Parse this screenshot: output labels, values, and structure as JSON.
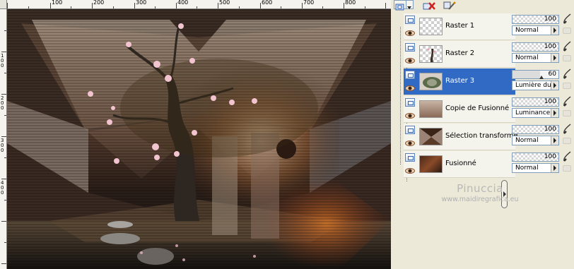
{
  "ruler": {
    "labels": [
      "100",
      "200",
      "300",
      "400",
      "500",
      "600",
      "700",
      "800"
    ],
    "vertical_labels": [
      "1",
      "0",
      "0",
      "2",
      "0",
      "0",
      "3",
      "0",
      "0",
      "4",
      "0",
      "0"
    ]
  },
  "toolbar": {
    "icons": [
      "new-layer-icon",
      "dropdown-arrow-icon",
      "delete-layer-icon",
      "layer-properties-icon"
    ]
  },
  "layers": [
    {
      "name": "Raster 1",
      "selected": false
    },
    {
      "name": "Raster 2",
      "selected": false
    },
    {
      "name": "Raster 3",
      "selected": true
    },
    {
      "name": "Copie de Fusionné",
      "selected": false
    },
    {
      "name": "Sélection transformé",
      "selected": false
    },
    {
      "name": "Fusionné",
      "selected": false
    }
  ],
  "properties": [
    {
      "opacity": "100",
      "blend": "Normal"
    },
    {
      "opacity": "100",
      "blend": "Normal"
    },
    {
      "opacity": "60",
      "blend": "Lumière dure"
    },
    {
      "opacity": "100",
      "blend": "Luminance"
    },
    {
      "opacity": "100",
      "blend": "Normal"
    },
    {
      "opacity": "100",
      "blend": "Normal"
    }
  ],
  "watermark": {
    "name": "Pinuccia",
    "url": "www.maidiregrafica.eu"
  },
  "colors": {
    "selection": "#316ac5",
    "palette_bg": "#ece9d8"
  }
}
